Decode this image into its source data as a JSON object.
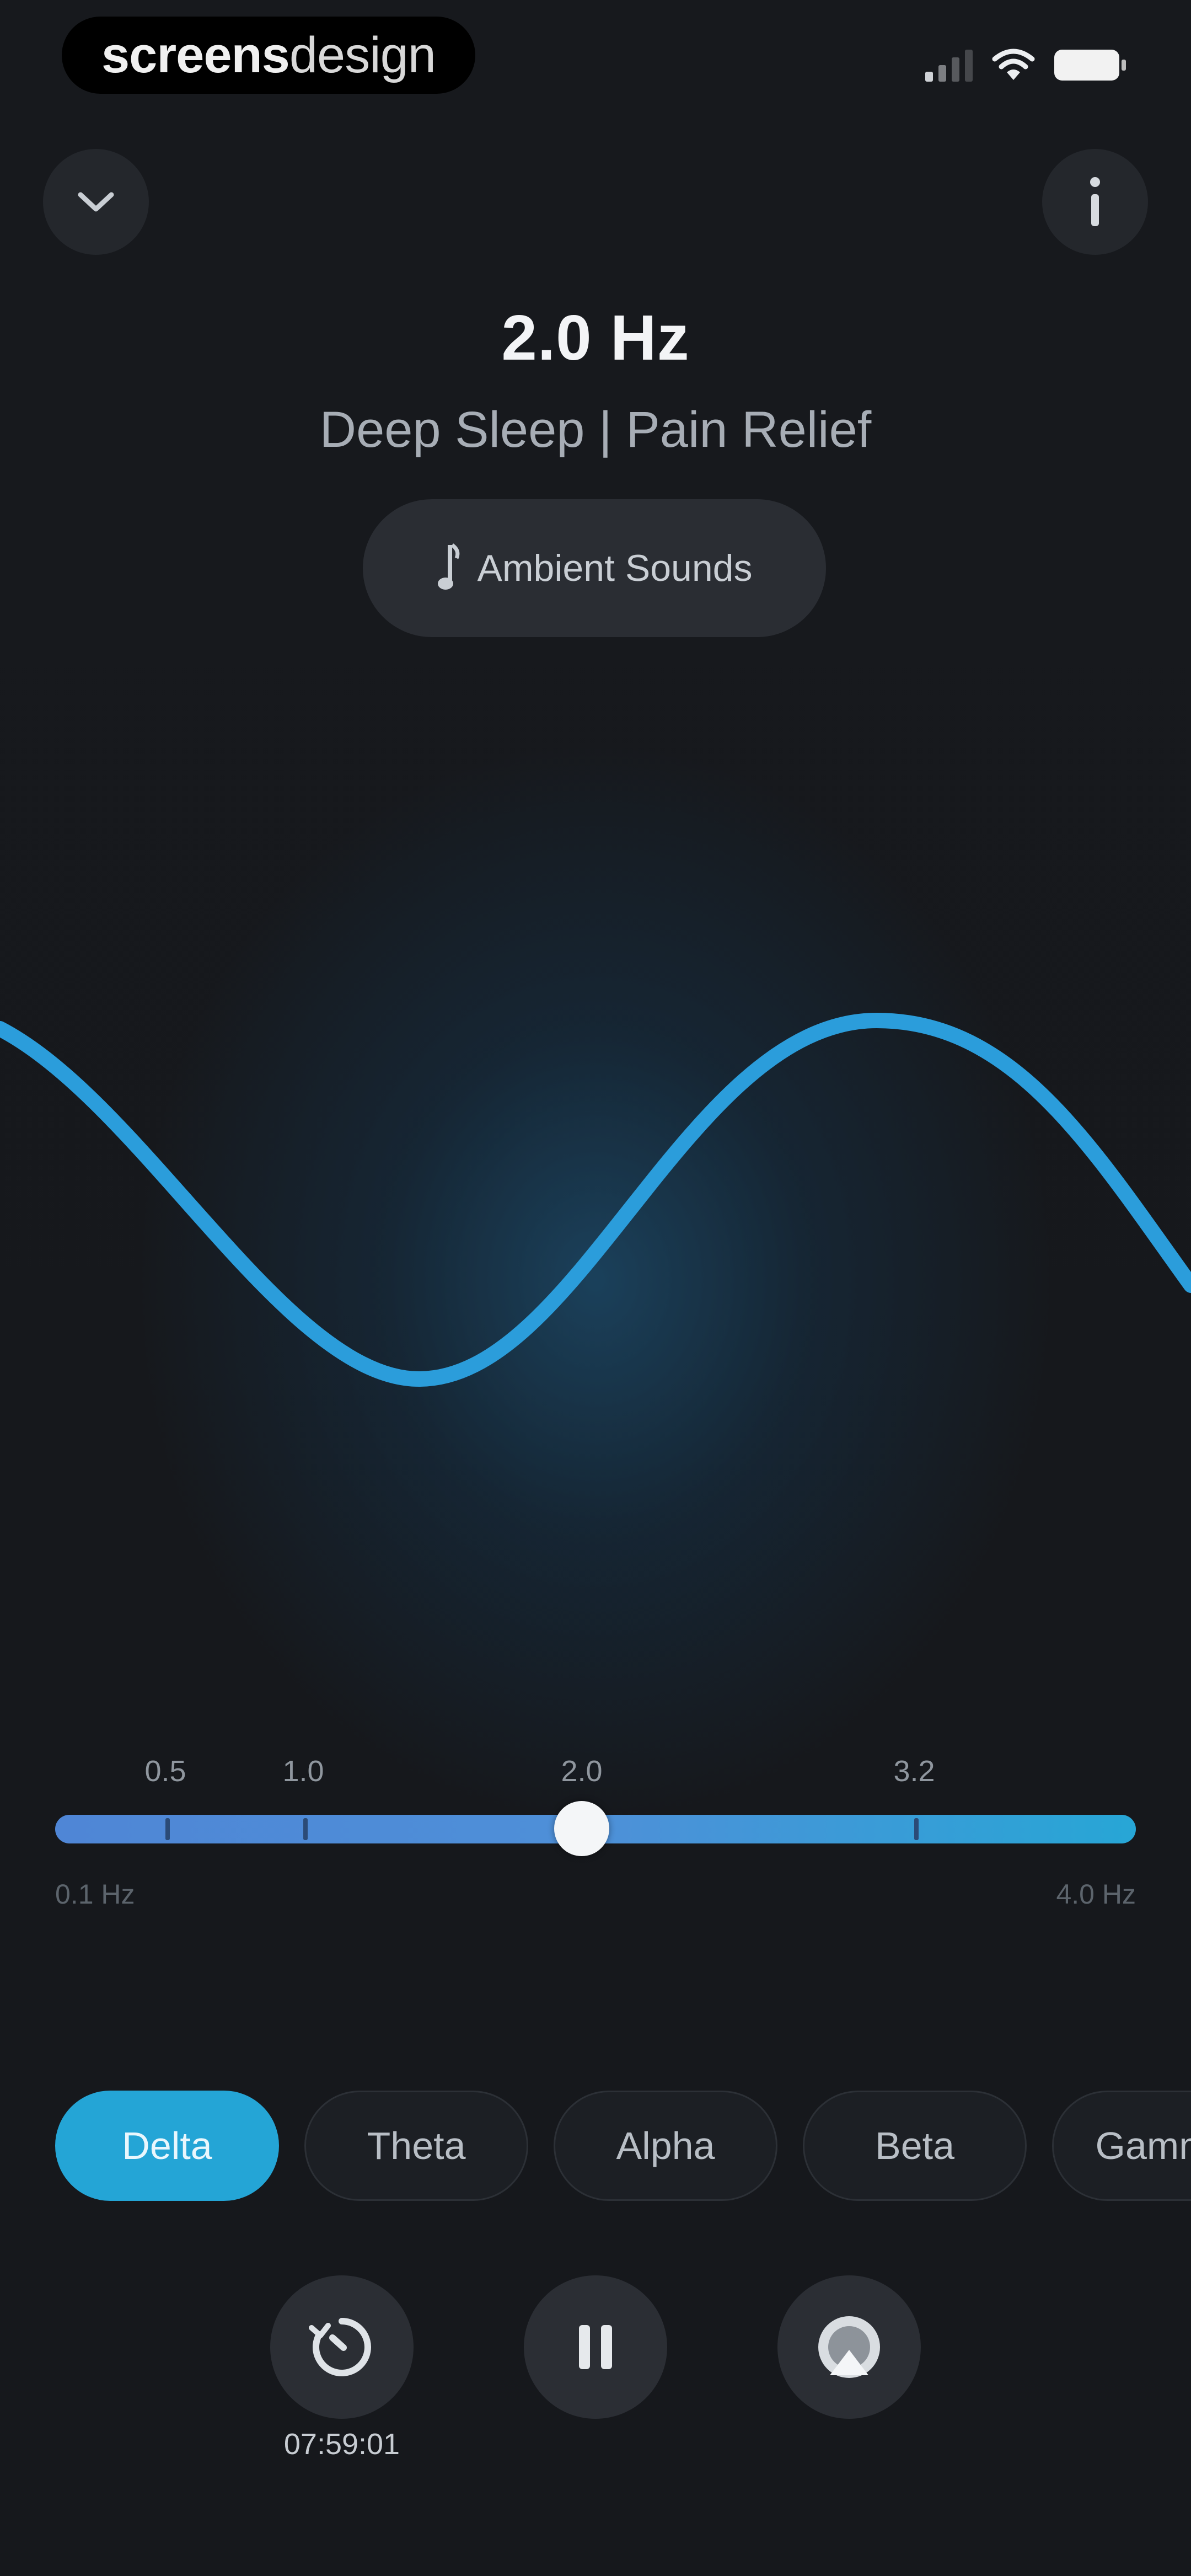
{
  "status_bar": {
    "brand_bold": "screens",
    "brand_light": "design"
  },
  "header": {
    "collapse_icon": "chevron-down-icon",
    "info_icon": "info-icon"
  },
  "title": {
    "frequency": "2.0 Hz",
    "subtitle": "Deep Sleep | Pain Relief"
  },
  "ambient": {
    "label": "Ambient Sounds",
    "icon": "music-note-icon"
  },
  "slider": {
    "tick_labels": [
      "0.5",
      "1.0",
      "2.0",
      "3.2"
    ],
    "current_value": 2.0,
    "min_label": "0.1 Hz",
    "max_label": "4.0 Hz"
  },
  "bands": [
    {
      "label": "Delta",
      "active": true
    },
    {
      "label": "Theta",
      "active": false
    },
    {
      "label": "Alpha",
      "active": false
    },
    {
      "label": "Beta",
      "active": false
    },
    {
      "label": "Gamma",
      "active": false
    }
  ],
  "controls": {
    "timer_text": "07:59:01",
    "timer_icon": "timer-icon",
    "pause_icon": "pause-icon",
    "airplay_icon": "airplay-icon"
  },
  "colors": {
    "accent": "#24a5d6",
    "wave": "#2b9ddb",
    "background": "#16181c"
  }
}
